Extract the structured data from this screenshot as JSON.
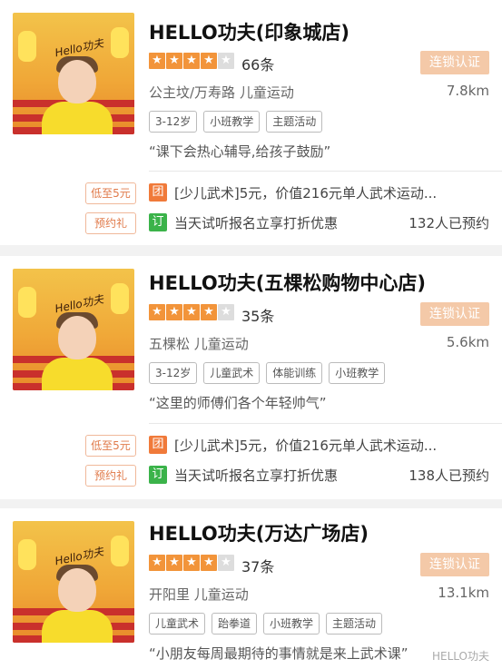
{
  "listings": [
    {
      "name": "HELLO功夫(印象城店)",
      "rating_stars": 4,
      "reviews": "66条",
      "chain_badge": "连锁认证",
      "area": "公主坟/万寿路  儿童运动",
      "distance": "7.8km",
      "tags": [
        "3-12岁",
        "小班教学",
        "主题活动"
      ],
      "quote": "“课下会热心辅导,给孩子鼓励”",
      "promo": {
        "label": "低至5元",
        "icon": "团",
        "text": "[少儿武术]5元，价值216元单人武术运动..."
      },
      "booking": {
        "label": "预约礼",
        "icon": "订",
        "text": "当天试听报名立享打折优惠",
        "count": "132人已预约"
      }
    },
    {
      "name": "HELLO功夫(五棵松购物中心店)",
      "rating_stars": 4,
      "reviews": "35条",
      "chain_badge": "连锁认证",
      "area": "五棵松  儿童运动",
      "distance": "5.6km",
      "tags": [
        "3-12岁",
        "儿童武术",
        "体能训练",
        "小班教学"
      ],
      "quote": "“这里的师傅们各个年轻帅气”",
      "promo": {
        "label": "低至5元",
        "icon": "团",
        "text": "[少儿武术]5元，价值216元单人武术运动..."
      },
      "booking": {
        "label": "预约礼",
        "icon": "订",
        "text": "当天试听报名立享打折优惠",
        "count": "138人已预约"
      }
    },
    {
      "name": "HELLO功夫(万达广场店)",
      "rating_stars": 4,
      "reviews": "37条",
      "chain_badge": "连锁认证",
      "area": "开阳里  儿童运动",
      "distance": "13.1km",
      "tags": [
        "儿童武术",
        "跆拳道",
        "小班教学",
        "主题活动"
      ],
      "quote": "“小朋友每周最期待的事情就是来上武术课”"
    }
  ],
  "thumbnail_brand": "Hello功夫",
  "star_glyph": "★",
  "watermark": "HELLO功夫",
  "colors": {
    "star_on": "#f2943a",
    "star_off": "#dddddd",
    "chain_badge": "#f4c9a8",
    "tuan_icon": "#f07a3a",
    "ding_icon": "#3bb34a"
  }
}
